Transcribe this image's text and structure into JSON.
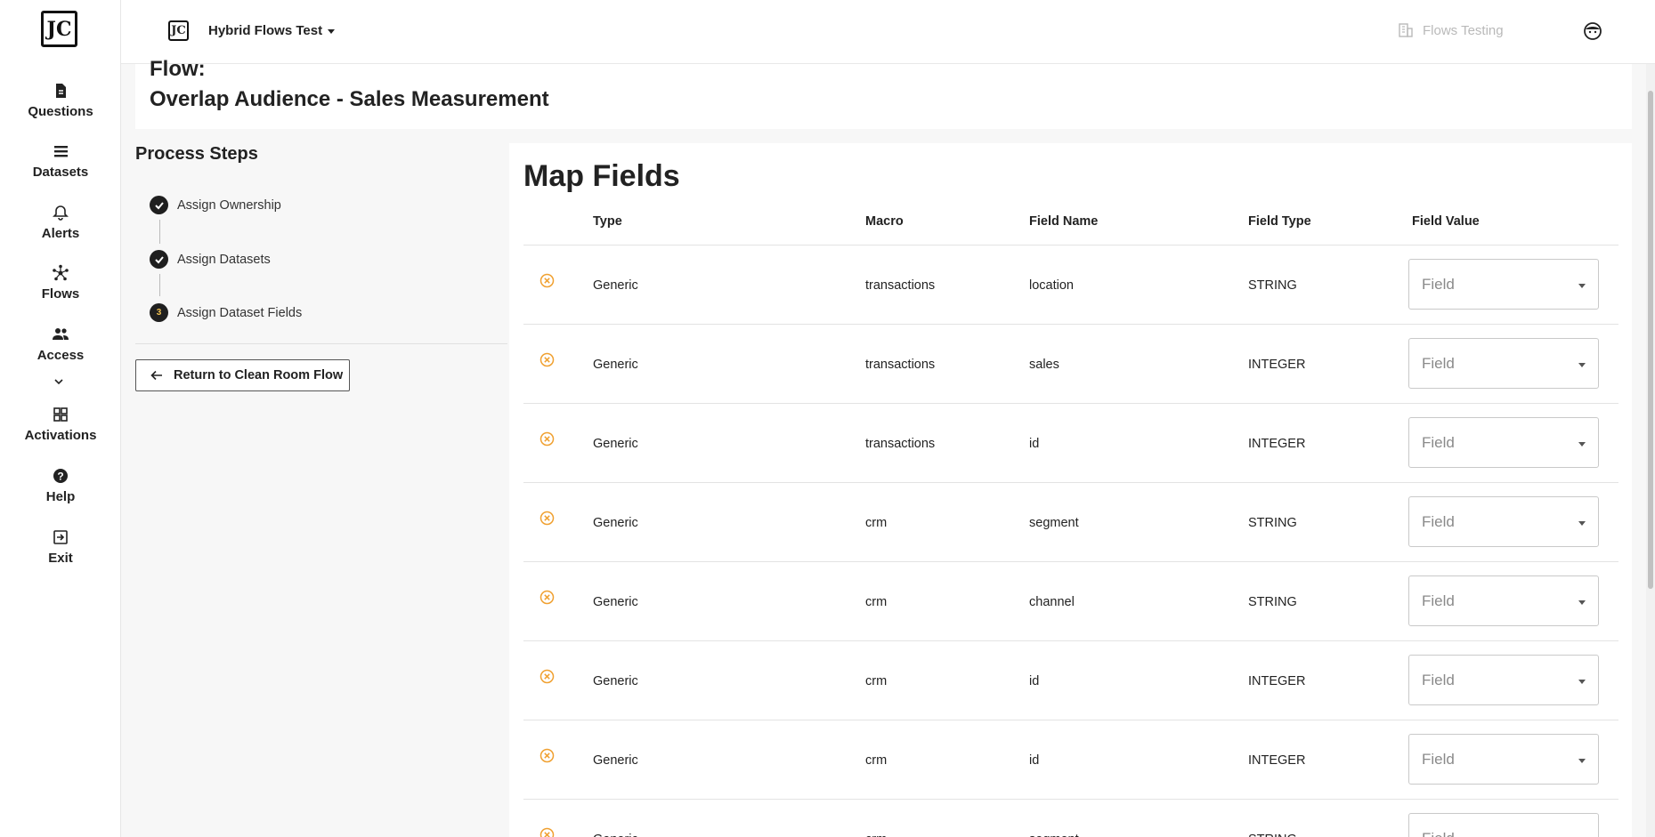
{
  "leftnav": {
    "logo": "JC",
    "items": [
      {
        "label": "Questions",
        "icon": "document-icon"
      },
      {
        "label": "Datasets",
        "icon": "list-icon"
      },
      {
        "label": "Alerts",
        "icon": "bell-icon"
      },
      {
        "label": "Flows",
        "icon": "flows-icon"
      },
      {
        "label": "Access",
        "icon": "people-icon"
      },
      {
        "label": "Activations",
        "icon": "grid-icon"
      },
      {
        "label": "Help",
        "icon": "help-icon"
      },
      {
        "label": "Exit",
        "icon": "exit-icon"
      }
    ]
  },
  "topbar": {
    "workspace": "Hybrid Flows Test",
    "org": "Flows Testing"
  },
  "flow": {
    "label": "Flow:",
    "name": "Overlap Audience - Sales Measurement"
  },
  "steps": {
    "title": "Process Steps",
    "items": [
      {
        "label": "Assign Ownership",
        "status": "done"
      },
      {
        "label": "Assign Datasets",
        "status": "done"
      },
      {
        "label": "Assign Dataset Fields",
        "status": "current",
        "number": "3"
      }
    ],
    "return_label": "Return to Clean Room Flow"
  },
  "map": {
    "title": "Map Fields",
    "columns": [
      "Type",
      "Macro",
      "Field Name",
      "Field Type",
      "Field Value"
    ],
    "placeholder": "Field",
    "rows": [
      {
        "type": "Generic",
        "macro": "transactions",
        "field_name": "location",
        "field_type": "STRING"
      },
      {
        "type": "Generic",
        "macro": "transactions",
        "field_name": "sales",
        "field_type": "INTEGER"
      },
      {
        "type": "Generic",
        "macro": "transactions",
        "field_name": "id",
        "field_type": "INTEGER"
      },
      {
        "type": "Generic",
        "macro": "crm",
        "field_name": "segment",
        "field_type": "STRING"
      },
      {
        "type": "Generic",
        "macro": "crm",
        "field_name": "channel",
        "field_type": "STRING"
      },
      {
        "type": "Generic",
        "macro": "crm",
        "field_name": "id",
        "field_type": "INTEGER"
      },
      {
        "type": "Generic",
        "macro": "crm",
        "field_name": "id",
        "field_type": "INTEGER"
      },
      {
        "type": "Generic",
        "macro": "crm",
        "field_name": "segment",
        "field_type": "STRING"
      }
    ]
  },
  "colors": {
    "warning_icon": "#f0a030",
    "text": "#222222"
  }
}
